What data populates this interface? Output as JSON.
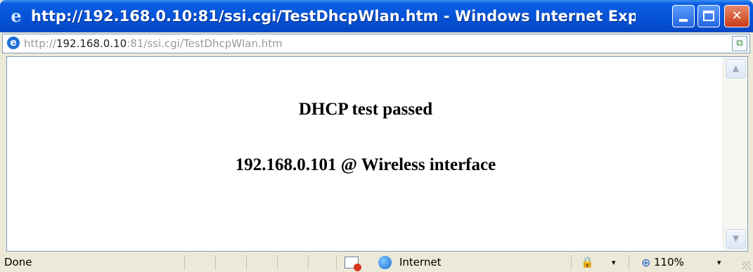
{
  "window": {
    "title": "http://192.168.0.10:81/ssi.cgi/TestDhcpWlan.htm - Windows Internet Expl...",
    "icon": "ie-icon",
    "buttons": {
      "minimize": "minimize-icon",
      "maximize": "maximize-icon",
      "close": "✕"
    }
  },
  "address": {
    "scheme": "http://",
    "host": "192.168.0.10",
    "rest": ":81/ssi.cgi/TestDhcpWlan.htm"
  },
  "content": {
    "line1": "DHCP test passed",
    "line2": "192.168.0.101 @ Wireless interface"
  },
  "scrollbar": {
    "up": "▲",
    "down": "▼"
  },
  "status": {
    "text": "Done",
    "zone": "Internet",
    "zoom": "110%",
    "caret": "▾"
  },
  "colors": {
    "titlebar": "#0553D6",
    "chrome": "#ECE9D8",
    "close_button": "#C83B17"
  }
}
